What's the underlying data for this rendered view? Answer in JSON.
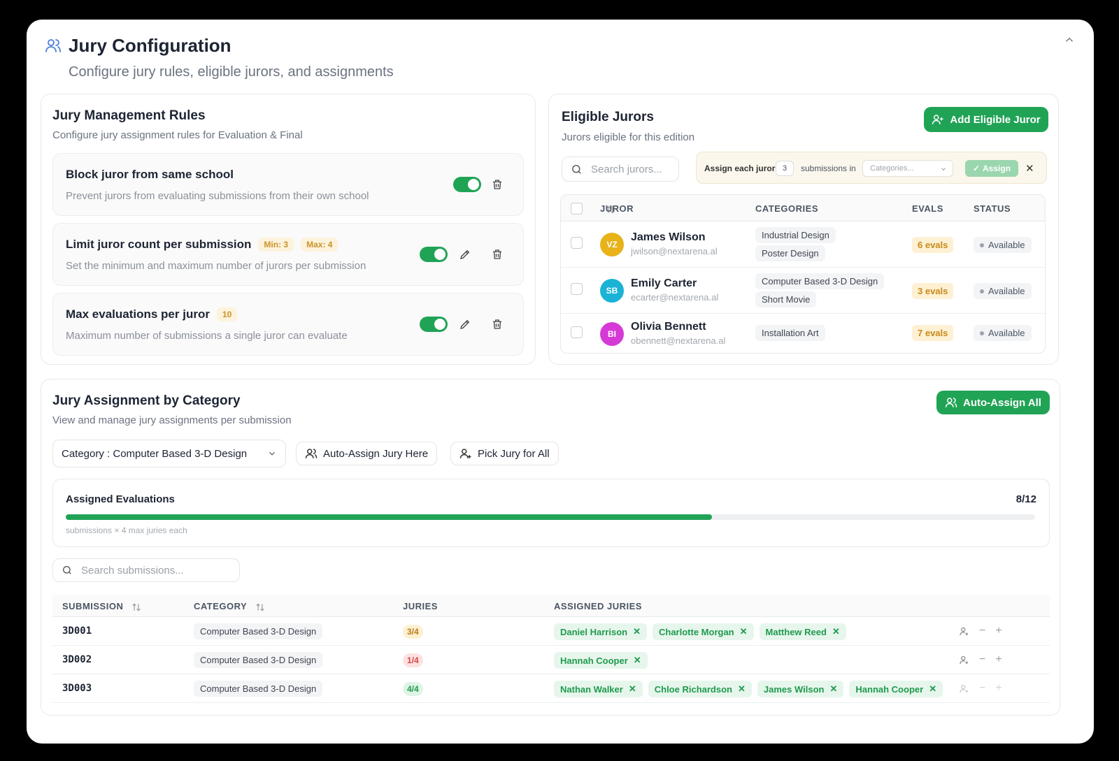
{
  "header": {
    "title": "Jury Configuration",
    "subtitle": "Configure jury rules, eligible jurors, and assignments"
  },
  "rules": {
    "title": "Jury Management Rules",
    "subtitle": "Configure jury assignment rules for Evaluation & Final",
    "items": [
      {
        "title": "Block juror from same school",
        "desc": "Prevent jurors from evaluating submissions from their own school",
        "enabled": true
      },
      {
        "title": "Limit juror count per submission",
        "min": "Min: 3",
        "max": "Max: 4",
        "desc": "Set the minimum and maximum number of jurors per submission",
        "enabled": true
      },
      {
        "title": "Max evaluations per juror",
        "badge": "10",
        "desc": "Maximum number of submissions a single juror can evaluate",
        "enabled": true
      }
    ]
  },
  "eligible": {
    "title": "Eligible Jurors",
    "subtitle": "Jurors eligible for this edition",
    "add_button": "Add Eligible Juror",
    "search_placeholder": "Search jurors...",
    "assign_bar": {
      "prefix": "Assign each juror",
      "count": "3",
      "middle": "submissions in",
      "select_placeholder": "Categories...",
      "assign_label": "Assign"
    },
    "columns": {
      "juror": "JUROR",
      "categories": "CATEGORIES",
      "evals": "EVALS",
      "status": "STATUS"
    },
    "rows": [
      {
        "initials": "VZ",
        "color": "#e8b21a",
        "name": "James Wilson",
        "email": "jwilson@nextarena.al",
        "categories": [
          "Industrial Design",
          "Poster Design"
        ],
        "evals": "6 evals",
        "status": "Available"
      },
      {
        "initials": "SB",
        "color": "#1ab3d6",
        "name": "Emily Carter",
        "email": "ecarter@nextarena.al",
        "categories": [
          "Computer Based 3-D Design",
          "Short Movie"
        ],
        "evals": "3 evals",
        "status": "Available"
      },
      {
        "initials": "BI",
        "color": "#d63ad6",
        "name": "Olivia Bennett",
        "email": "obennett@nextarena.al",
        "categories": [
          "Installation Art"
        ],
        "evals": "7 evals",
        "status": "Available"
      }
    ]
  },
  "assignment": {
    "title": "Jury Assignment by Category",
    "subtitle": "View and manage jury assignments per submission",
    "auto_assign_all": "Auto-Assign All",
    "category_select": "Category : Computer Based 3-D Design",
    "auto_assign_here": "Auto-Assign Jury Here",
    "pick_jury": "Pick Jury for All",
    "progress": {
      "label": "Assigned Evaluations",
      "value": "8/12",
      "fraction": 0.667,
      "note": "submissions × 4 max juries each"
    },
    "search_placeholder": "Search submissions...",
    "columns": {
      "submission": "SUBMISSION",
      "category": "CATEGORY",
      "juries": "JURIES",
      "assigned": "ASSIGNED JURIES"
    },
    "rows": [
      {
        "id": "3D001",
        "category": "Computer Based 3-D Design",
        "juries": "3/4",
        "juries_style": "warn",
        "assigned": [
          "Daniel Harrison",
          "Charlotte Morgan",
          "Matthew Reed"
        ]
      },
      {
        "id": "3D002",
        "category": "Computer Based 3-D Design",
        "juries": "1/4",
        "juries_style": "bad",
        "assigned": [
          "Hannah Cooper"
        ]
      },
      {
        "id": "3D003",
        "category": "Computer Based 3-D Design",
        "juries": "4/4",
        "juries_style": "good",
        "assigned": [
          "Nathan Walker",
          "Chloe Richardson",
          "James Wilson",
          "Hannah Cooper"
        ]
      }
    ]
  },
  "colors": {
    "accent": "#21a356",
    "warn": "#c88a1a",
    "bad": "#d64545"
  }
}
